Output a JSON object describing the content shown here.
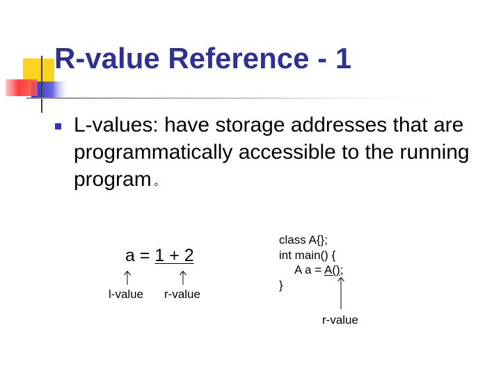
{
  "slide": {
    "title": "R-value Reference - 1",
    "bullets": [
      {
        "text": "L-values: have storage addresses that are programmatically accessible to the running program",
        "trailing_mark": "。"
      }
    ]
  },
  "example_left": {
    "lhs": "a =",
    "rhs": "1 + 2",
    "label_left": "l-value",
    "label_right": "r-value"
  },
  "example_right": {
    "code_line_1": "class A{};",
    "code_line_2": "int main() {",
    "code_line_3_prefix": "A a = ",
    "code_line_3_call": "A()",
    "code_line_3_suffix": ";",
    "code_line_4": "}",
    "label": "r-value"
  },
  "colors": {
    "title": "#2e3192",
    "bullet": "#3333cc",
    "deco_yellow": "#ffd21f",
    "deco_red": "#ff3b3b",
    "deco_blue": "#3a36c8"
  }
}
